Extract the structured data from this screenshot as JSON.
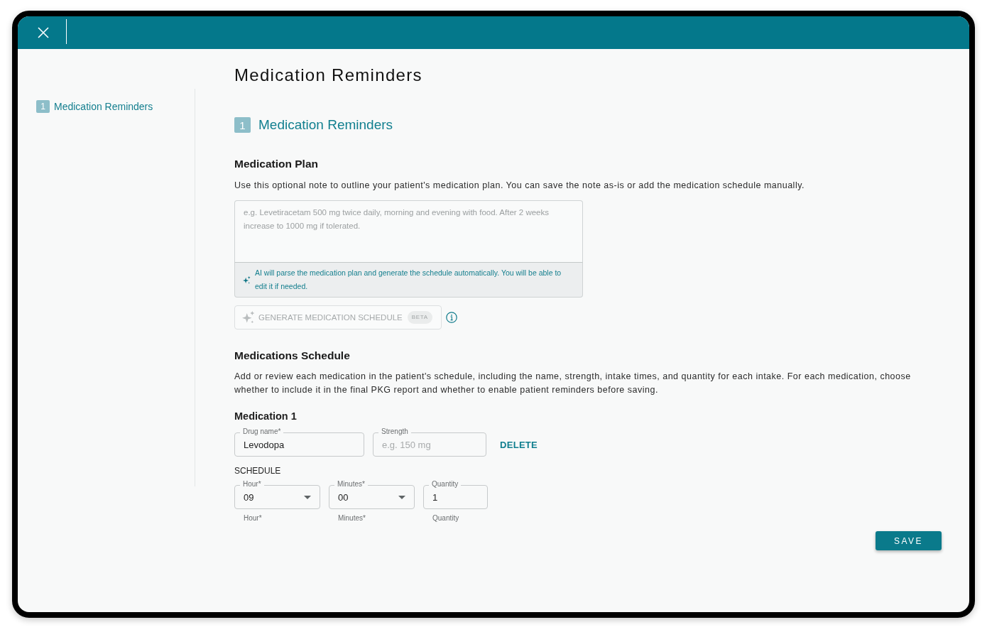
{
  "sidebar": {
    "steps": [
      {
        "number": "1",
        "label": "Medication Reminders",
        "selected": true
      }
    ]
  },
  "page_title": "Medication Reminders",
  "section": {
    "number": "1",
    "title": "Medication Reminders"
  },
  "medication_plan": {
    "heading": "Medication Plan",
    "description": "Use this optional note to outline your patient's medication plan. You can save the note as-is or add the medication schedule manually.",
    "note": {
      "placeholder": "e.g. Levetiracetam 500 mg twice daily, morning and evening with food. After 2 weeks increase to 1000 mg if tolerated."
    },
    "ai_hint": "AI will parse the medication plan and generate the schedule automatically. You will be able to edit it if needed.",
    "generate_button": {
      "label": "GENERATE MEDICATION SCHEDULE",
      "badge": "BETA",
      "disabled": true
    }
  },
  "medications_schedule": {
    "heading": "Medications Schedule",
    "description": "Add or review each medication in the patient's schedule, including the name, strength, intake times, and quantity for each intake. For each medication, choose whether to include it in the final PKG report and whether to enable patient reminders before saving.",
    "medications": [
      {
        "title": "Medication 1",
        "fields": [
          {
            "label": "Drug name*",
            "value": "Levodopa"
          },
          {
            "label": "Strength",
            "placeholder": "e.g. 150 mg"
          }
        ],
        "delete_label": "DELETE",
        "schedule_heading": "SCHEDULE",
        "intakes": [
          {
            "fields": [
              {
                "kind": "select",
                "label": "Hour*",
                "value": "09"
              },
              {
                "kind": "select",
                "label": "Minutes*",
                "value": "00"
              },
              {
                "kind": "number",
                "label": "Quantity",
                "value": "1"
              }
            ]
          },
          {
            "fields": [
              {
                "kind": "select",
                "label": "Hour*"
              },
              {
                "kind": "select",
                "label": "Minutes*"
              },
              {
                "kind": "number",
                "label": "Quantity"
              }
            ]
          }
        ]
      }
    ]
  },
  "footer": {
    "save_label": "SAVE"
  }
}
